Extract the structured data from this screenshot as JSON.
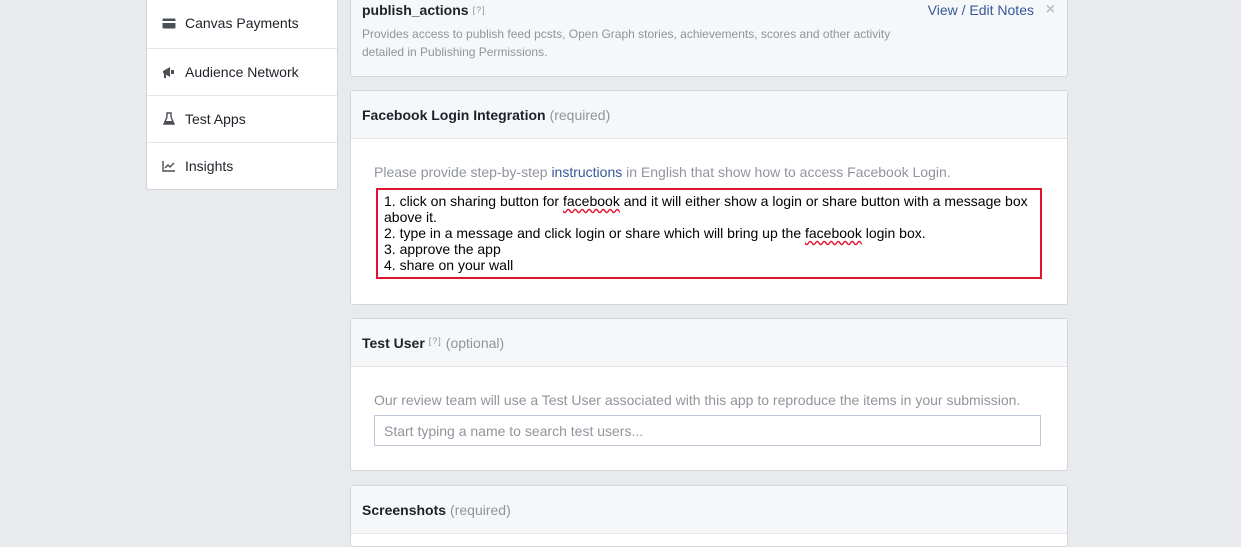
{
  "sidebar": {
    "items": [
      {
        "label": "Canvas Payments",
        "icon": "card-icon"
      },
      {
        "label": "Audience Network",
        "icon": "megaphone-icon"
      },
      {
        "label": "Test Apps",
        "icon": "flask-icon"
      },
      {
        "label": "Insights",
        "icon": "chart-icon"
      }
    ]
  },
  "publish": {
    "name": "publish_actions",
    "help": "[?]",
    "description": "Provides access to publish feed pcsts, Open Graph stories, achievements, scores and other activity detailed in Publishing Permissions.",
    "view_edit_label": "View / Edit Notes",
    "close_glyph": "×"
  },
  "login_integration": {
    "title": "Facebook Login Integration",
    "qualifier": "(required)",
    "prompt_before": "Please provide step-by-step",
    "prompt_link": "instructions",
    "prompt_after": "in English that show how to access Facebook Login.",
    "lines": {
      "l1_a": "1. click on sharing button for ",
      "l1_b": "facebook",
      "l1_c": " and it will either show a login or share button with a message box above it.",
      "l2_a": "2. type in a message and click login or share which will bring up the ",
      "l2_b": "facebook",
      "l2_c": " login box.",
      "l3": "3. approve the app",
      "l4": "4. share on your wall"
    },
    "highlight_color": "#e0142e"
  },
  "test_user": {
    "title": "Test User",
    "help": "[?]",
    "qualifier": "(optional)",
    "prompt": "Our review team will use a Test User associated with this app to reproduce the items in your submission.",
    "placeholder": "Start typing a name to search test users..."
  },
  "screenshots": {
    "title": "Screenshots",
    "qualifier": "(required)"
  },
  "colors": {
    "link": "#365899",
    "background": "#e9eaed",
    "muted": "#90949c"
  }
}
